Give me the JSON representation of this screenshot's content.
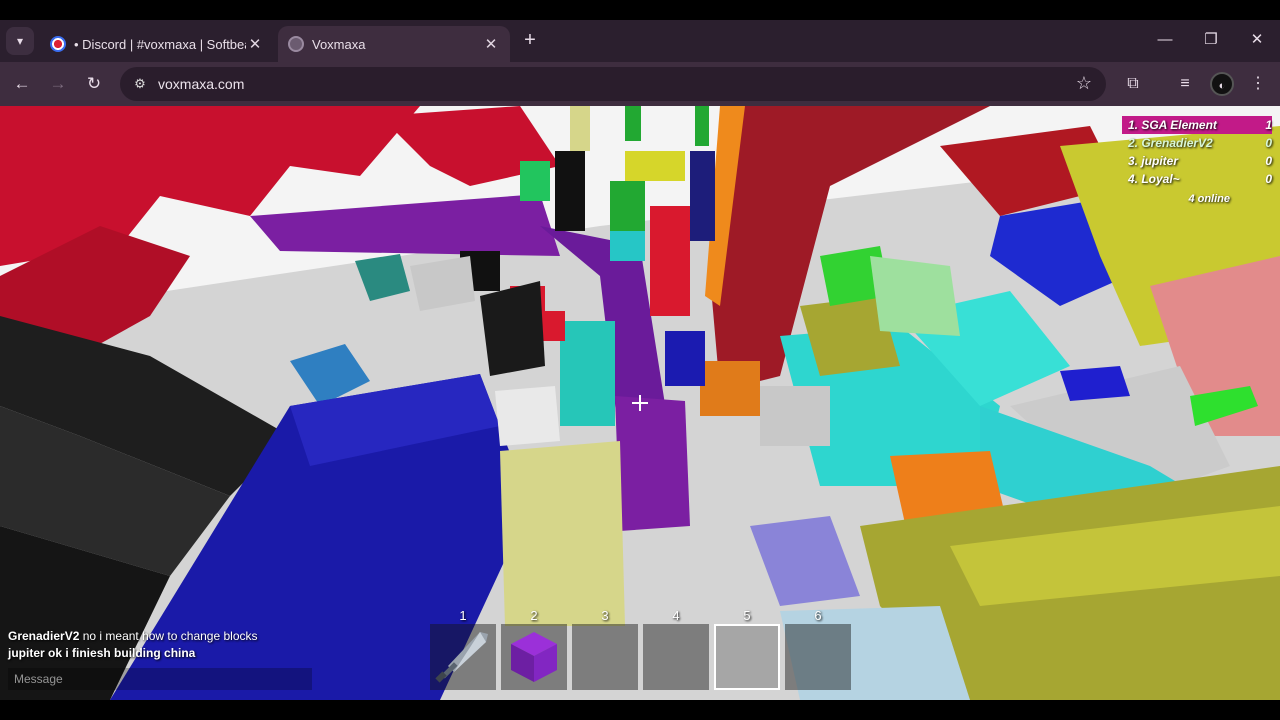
{
  "browser": {
    "tabs": [
      {
        "label": "• Discord | #voxmaxa | Softbear",
        "active": false,
        "favicon": "chrome-recording-icon"
      },
      {
        "label": "Voxmaxa",
        "active": true,
        "favicon": "globe-icon"
      }
    ],
    "url": "voxmaxa.com",
    "icons": {
      "tab_menu": "chevron-down-icon",
      "new_tab": "plus-icon",
      "back": "arrow-left-icon",
      "forward": "arrow-right-icon",
      "reload": "reload-icon",
      "site_info": "tune-icon",
      "bookmark": "star-icon",
      "extensions": "puzzle-icon",
      "media": "media-queue-icon",
      "profile": "profile-icon",
      "menu": "kebab-menu-icon"
    },
    "colors": {
      "tabstrip": "#2b1f2e",
      "toolbar": "#3e2d3f",
      "omnibox": "#2a1d2c"
    }
  },
  "game": {
    "leaderboard": [
      {
        "rank_name": "1. SGA Element",
        "score": "1"
      },
      {
        "rank_name": "2. GrenadierV2",
        "score": "0"
      },
      {
        "rank_name": "3. jupiter",
        "score": "0"
      },
      {
        "rank_name": "4. Loyal~",
        "score": "0"
      }
    ],
    "online": "4 online",
    "chat": [
      {
        "who": "GrenadierV2",
        "text": "no i meant how to change blocks",
        "who_bold": false
      },
      {
        "who": "jupiter",
        "text": "ok i finiesh building china",
        "who_bold": true
      }
    ],
    "chat_placeholder": "Message",
    "hotbar": {
      "selected": 5,
      "slots": [
        {
          "number": "1",
          "item": "sword-icon"
        },
        {
          "number": "2",
          "item": "purple-block-icon"
        },
        {
          "number": "3",
          "item": ""
        },
        {
          "number": "4",
          "item": ""
        },
        {
          "number": "5",
          "item": ""
        },
        {
          "number": "6",
          "item": ""
        }
      ]
    }
  }
}
